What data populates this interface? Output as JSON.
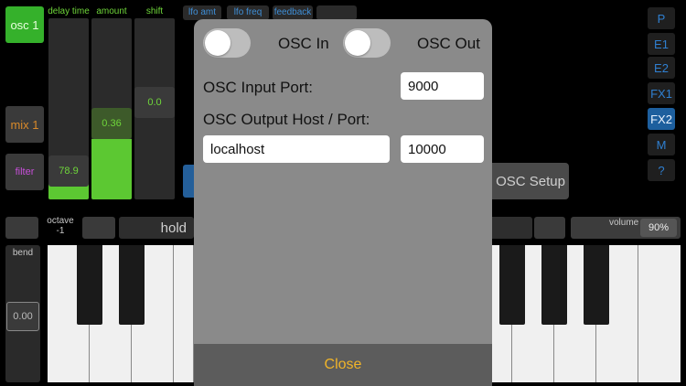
{
  "left_buttons": {
    "osc1": "osc 1",
    "mix1": "mix 1",
    "filter": "filter"
  },
  "sliders": [
    {
      "label": "delay time",
      "value": "78.9",
      "level": 0.12
    },
    {
      "label": "amount",
      "value": "0.36",
      "level": 0.36
    },
    {
      "label": "shift",
      "value": "0.0",
      "level": 0.0
    }
  ],
  "top_tabs": [
    "lfo amt",
    "lfo freq",
    "feedback"
  ],
  "right_nav": [
    "P",
    "E1",
    "E2",
    "FX1",
    "FX2",
    "M",
    "?"
  ],
  "right_nav_active": "FX2",
  "background_button": "OSC Setup",
  "octave": {
    "label": "octave",
    "value": "-1"
  },
  "hold_label": "hold",
  "volume": {
    "label": "volume",
    "value": "90%"
  },
  "bend": {
    "label": "bend",
    "value": "0.00"
  },
  "dialog": {
    "osc_in_label": "OSC In",
    "osc_in_on": false,
    "osc_out_label": "OSC Out",
    "osc_out_on": false,
    "input_port_label": "OSC Input Port:",
    "input_port_value": "9000",
    "output_label": "OSC Output Host / Port:",
    "output_host_value": "localhost",
    "output_port_value": "10000",
    "close_label": "Close"
  },
  "colors": {
    "accent_green": "#5cc832",
    "accent_blue": "#2f7fd0",
    "close_text": "#f0b429"
  }
}
